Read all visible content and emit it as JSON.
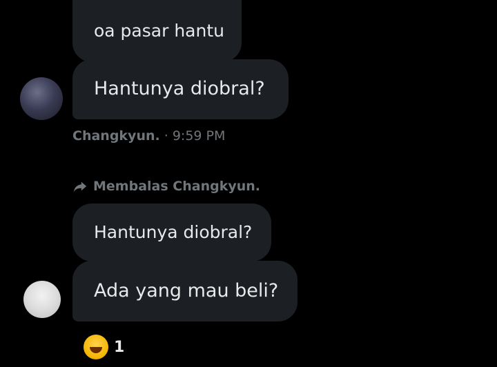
{
  "messages": [
    {
      "text": "oa pasar hantu"
    },
    {
      "text": "Hantunya diobral?"
    },
    {
      "text": "Hantunya diobral?"
    },
    {
      "text": "Ada yang mau beli?"
    }
  ],
  "meta": {
    "sender": "Changkyun.",
    "separator": " · ",
    "time": "9:59 PM"
  },
  "reply": {
    "icon": "reply-arrow-icon",
    "label": "Membalas Changkyun."
  },
  "reaction": {
    "emoji": "laughing-emoji-icon",
    "count": "1"
  },
  "colors": {
    "background": "#000000",
    "bubble": "#1c1f23",
    "text": "#e7e9ea",
    "muted": "#71767b"
  }
}
